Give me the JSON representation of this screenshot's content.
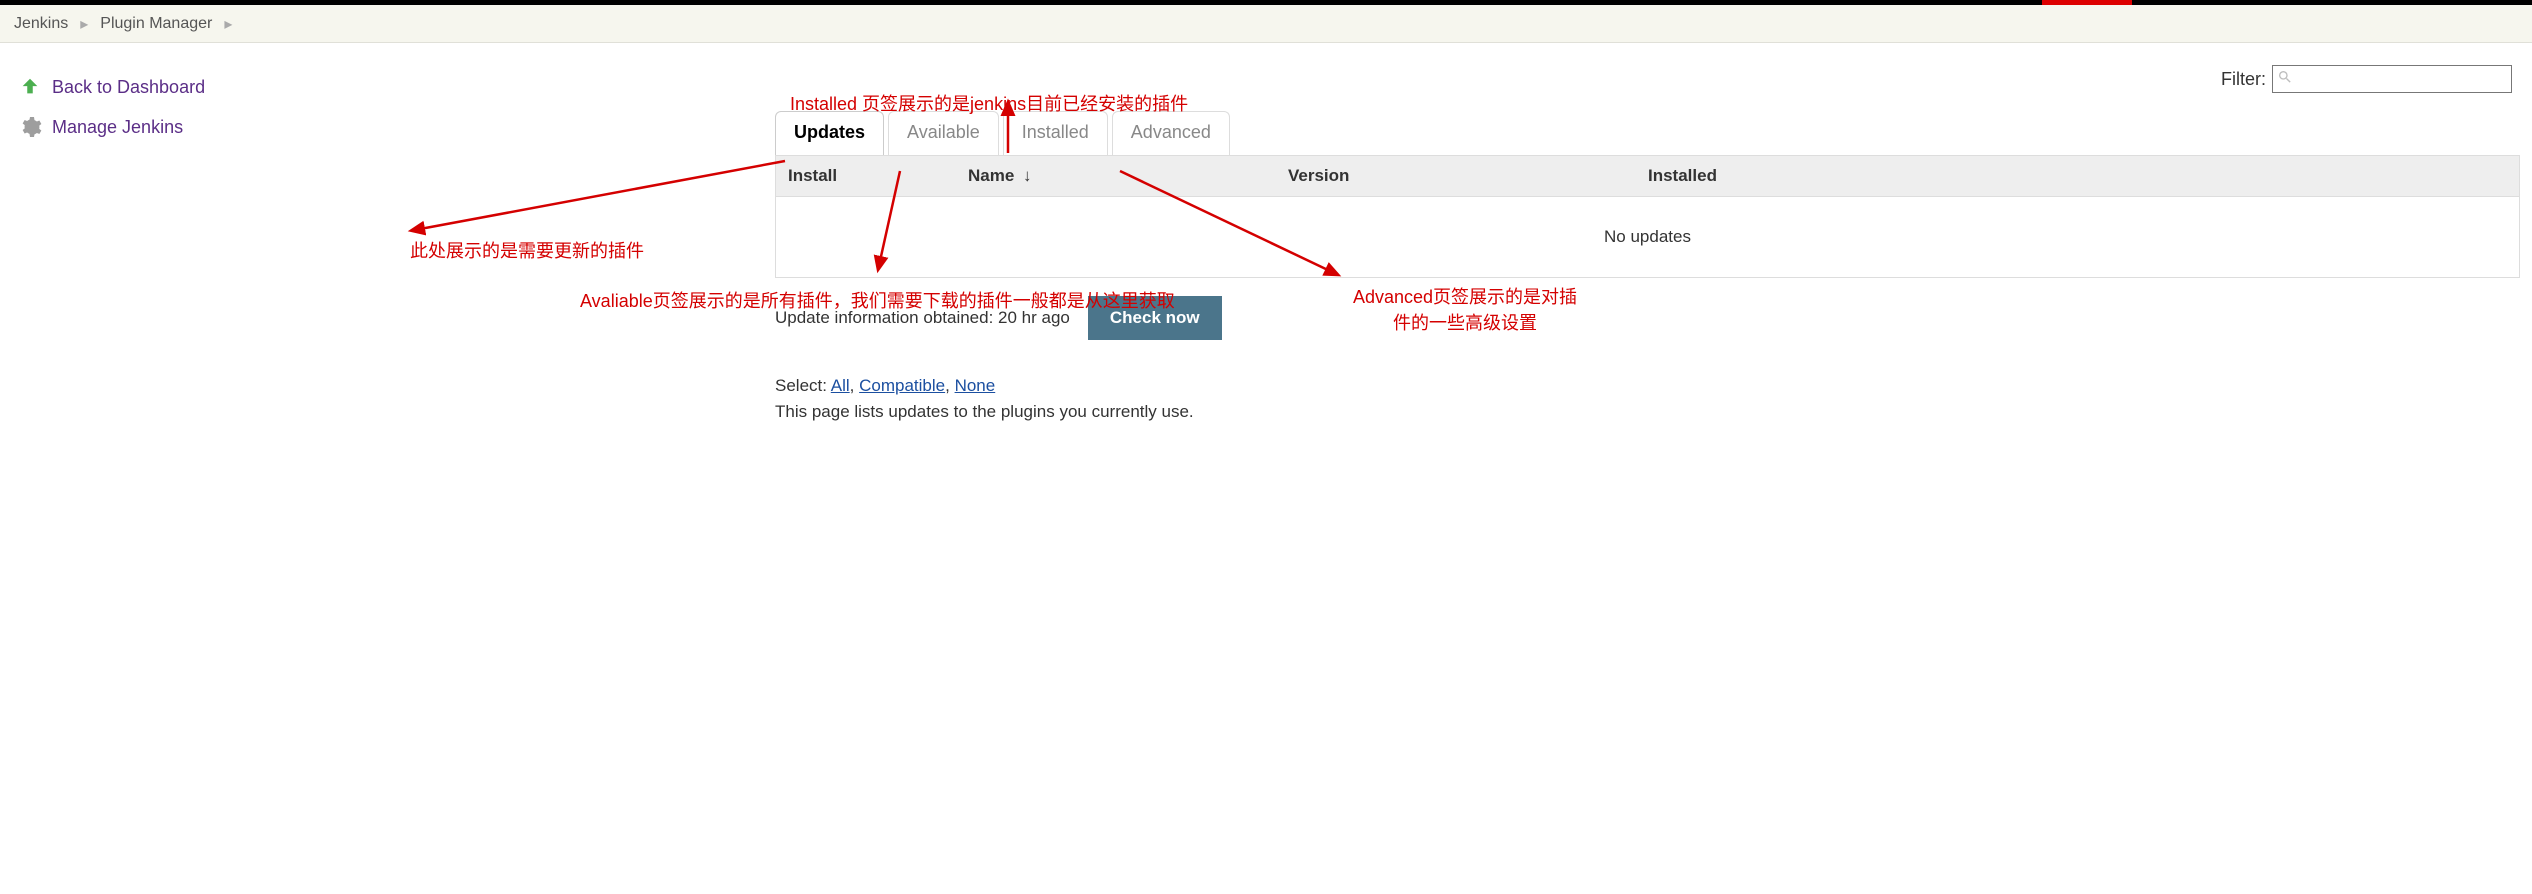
{
  "breadcrumb": {
    "jenkins": "Jenkins",
    "pluginManager": "Plugin Manager"
  },
  "sidebar": {
    "backToDashboard": "Back to Dashboard",
    "manageJenkins": "Manage Jenkins"
  },
  "filter": {
    "label": "Filter:",
    "placeholder": ""
  },
  "tabs": {
    "updates": "Updates",
    "available": "Available",
    "installed": "Installed",
    "advanced": "Advanced"
  },
  "table": {
    "headers": {
      "install": "Install",
      "name": "Name",
      "version": "Version",
      "installed": "Installed"
    },
    "sortIndicator": "↓",
    "emptyMessage": "No updates"
  },
  "updateInfo": {
    "obtained": "Update information obtained: 20 hr ago",
    "checkNow": "Check now"
  },
  "selectRow": {
    "prefix": "Select: ",
    "all": "All",
    "compatible": "Compatible",
    "none": "None",
    "sep": ", "
  },
  "hint": "This page lists updates to the plugins you currently use.",
  "annotations": {
    "installed": "Installed 页签展示的是jenkins目前已经安装的插件",
    "updates": "此处展示的是需要更新的插件",
    "available": "Avaliable页签展示的是所有插件，我们需要下载的插件一般都是从这里获取",
    "advanced_line1": "Advanced页签展示的是对插",
    "advanced_line2": "件的一些高级设置"
  }
}
